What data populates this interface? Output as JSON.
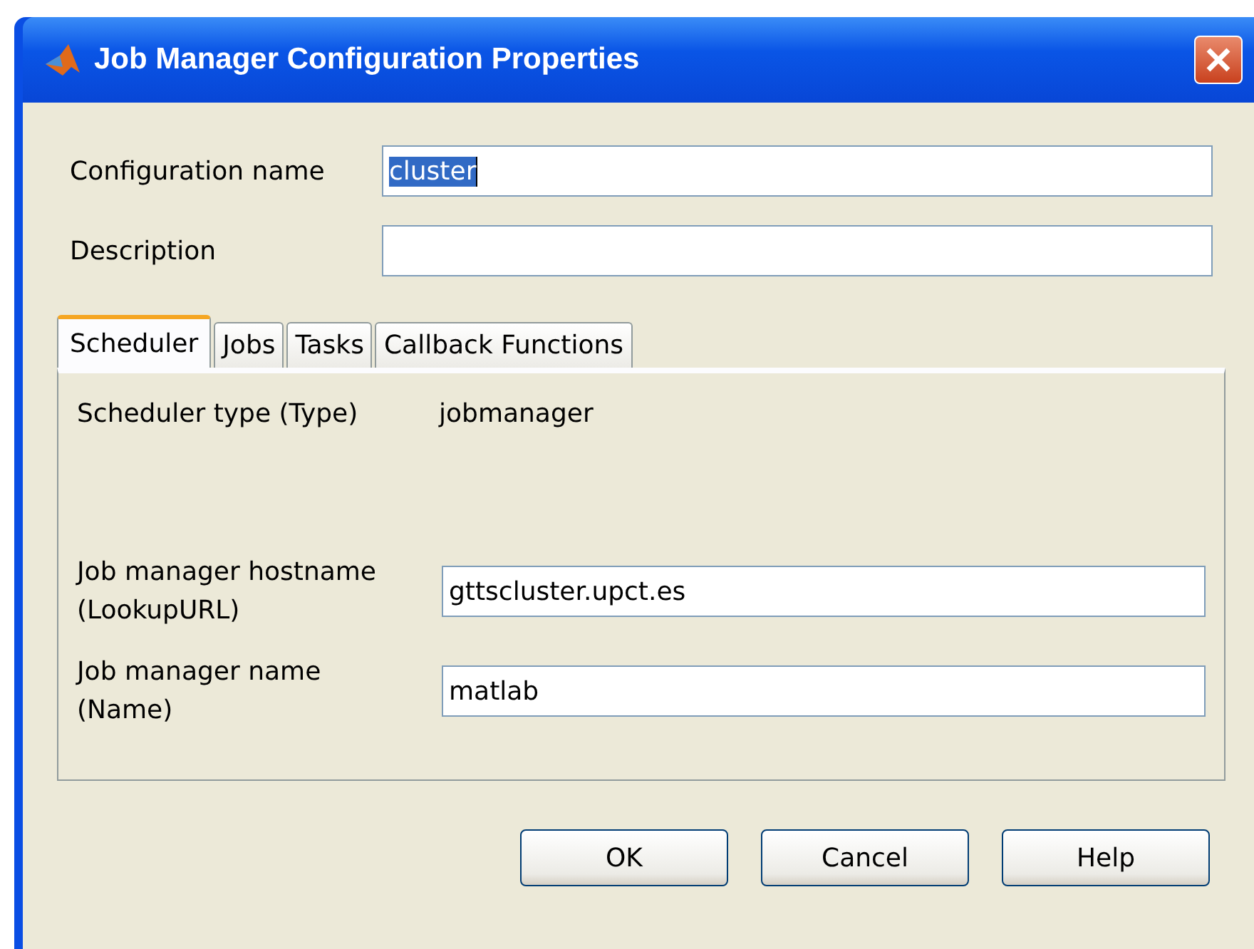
{
  "window": {
    "title": "Job Manager Configuration Properties"
  },
  "fields": [
    {
      "label": "Configuration name",
      "value": "cluster",
      "text_selected": true
    },
    {
      "label": "Description"
    }
  ],
  "tabs": [
    {
      "label": "Scheduler",
      "selected": true
    },
    {
      "label": "Jobs",
      "selected": false
    },
    {
      "label": "Tasks",
      "selected": false
    },
    {
      "label": "Callback Functions",
      "selected": false
    }
  ],
  "scheduler": {
    "type_label": "Scheduler type (Type)",
    "type_value": "jobmanager",
    "fields": [
      {
        "label": "Job manager hostname",
        "sublabel": "(LookupURL)",
        "value": "gttscluster.upct.es"
      },
      {
        "label": "Job manager name",
        "sublabel": "(Name)",
        "value": "matlab"
      }
    ]
  },
  "buttons": [
    "OK",
    "Cancel",
    "Help"
  ]
}
